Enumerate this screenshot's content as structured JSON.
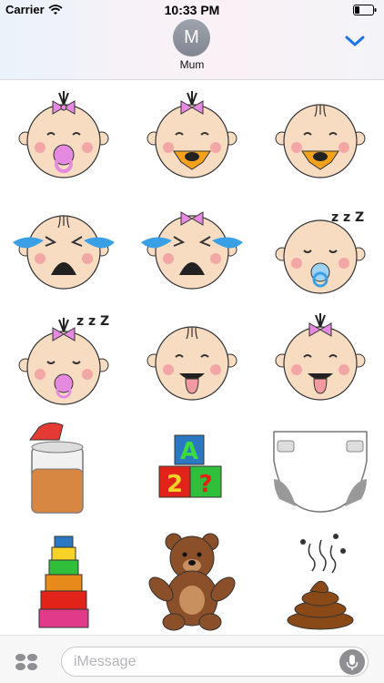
{
  "status_bar": {
    "carrier": "Carrier",
    "time": "10:33 PM"
  },
  "header": {
    "avatar_initial": "M",
    "contact_name": "Mum"
  },
  "stickers": [
    {
      "name": "baby-girl-pacifier"
    },
    {
      "name": "baby-girl-duck-pacifier"
    },
    {
      "name": "baby-boy-duck-pacifier"
    },
    {
      "name": "baby-boy-crying"
    },
    {
      "name": "baby-girl-crying"
    },
    {
      "name": "baby-boy-sleeping"
    },
    {
      "name": "baby-girl-sleeping"
    },
    {
      "name": "baby-boy-tongue"
    },
    {
      "name": "baby-girl-tongue"
    },
    {
      "name": "baby-food-jar"
    },
    {
      "name": "abc-blocks"
    },
    {
      "name": "diaper"
    },
    {
      "name": "stacking-cups"
    },
    {
      "name": "teddy-bear"
    },
    {
      "name": "poop"
    }
  ],
  "blocks": {
    "top": "A",
    "left": "2",
    "right": "?"
  },
  "sleep_text": "z z Z",
  "input": {
    "placeholder": "iMessage"
  },
  "colors": {
    "accent": "#1a73e8",
    "skin": "#f7dcc2",
    "pink": "#e58ae0",
    "blue_tears": "#3aa0e6"
  }
}
